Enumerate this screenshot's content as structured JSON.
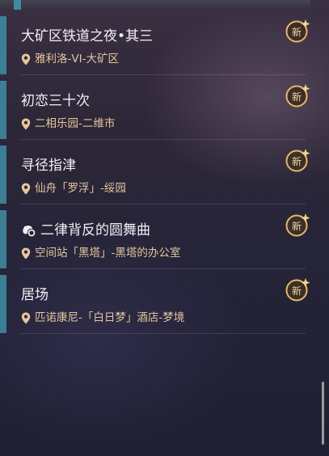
{
  "quests": [
    {
      "title": "大矿区铁道之夜•其三",
      "location": "雅利洛-VI-大矿区",
      "badge": "新"
    },
    {
      "title": "初恋三十次",
      "location": "二相乐园-二维市",
      "badge": "新"
    },
    {
      "title": "寻径指津",
      "location": "仙舟「罗浮」-绥园",
      "badge": "新"
    },
    {
      "title": "二律背反的圆舞曲",
      "location": "空间站「黑塔」-黑塔的办公室",
      "badge": "新"
    },
    {
      "title": "居场",
      "location": "匹诺康尼-「白日梦」酒店-梦境",
      "badge": "新"
    }
  ],
  "colors": {
    "accent": "#3b7f95",
    "location_text": "#e4c79a",
    "badge_gold": "#e8b860"
  },
  "icons": {
    "location": "map-pin-icon",
    "new": "new-badge-icon",
    "special_quest": "quest-type-icon"
  }
}
